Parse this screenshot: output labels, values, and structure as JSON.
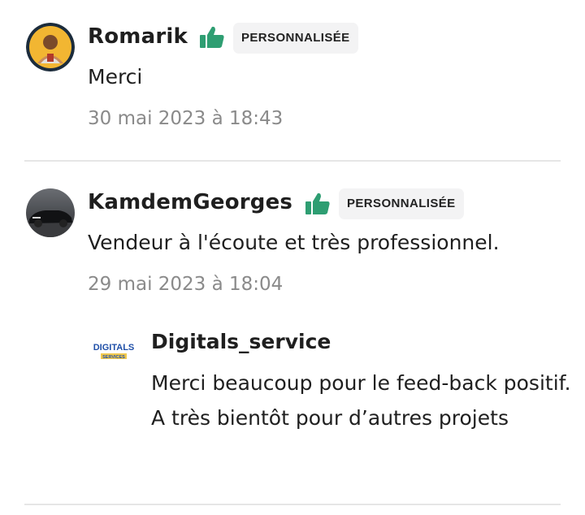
{
  "reviews": [
    {
      "username": "Romarik",
      "badge": "PERSONNALISÉE",
      "comment": "Merci",
      "date": "30 mai 2023 à 18:43",
      "avatar_icon": "user-photo-avatar",
      "thumb_icon": "thumbs-up-icon"
    },
    {
      "username": "KamdemGeorges",
      "badge": "PERSONNALISÉE",
      "comment": "Vendeur à l'écoute et très professionnel.",
      "date": "29 mai 2023 à 18:04",
      "avatar_icon": "car-photo-avatar",
      "thumb_icon": "thumbs-up-icon",
      "reply": {
        "name": "Digitals_service",
        "text": "Merci beaucoup pour le feed-back positif. A très bientôt pour d’autres projets",
        "logo_text": "DIGITALS",
        "logo_subtext": "SERVICES"
      }
    }
  ],
  "colors": {
    "thumb_green": "#2e9e72",
    "badge_bg": "#f3f3f4",
    "date_gray": "#8a8a8a",
    "divider": "#e6e6e6",
    "logo_blue": "#1f4fa8"
  }
}
